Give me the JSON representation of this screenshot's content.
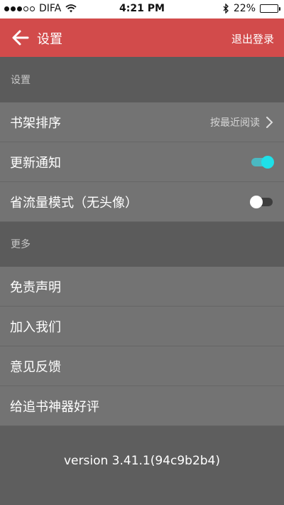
{
  "status_bar": {
    "carrier": "DIFA",
    "time": "4:21 PM",
    "battery": "22%",
    "battery_level": 0.22
  },
  "header": {
    "title": "设置",
    "logout_label": "退出登录"
  },
  "sections": {
    "settings_label": "设置",
    "more_label": "更多"
  },
  "settings": {
    "shelf_sort_label": "书架排序",
    "shelf_sort_value": "按最近阅读",
    "update_notify_label": "更新通知",
    "update_notify_on": true,
    "save_data_label": "省流量模式（无头像）",
    "save_data_on": false
  },
  "more": {
    "disclaimer_label": "免责声明",
    "join_us_label": "加入我们",
    "feedback_label": "意见反馈",
    "rate_label": "给追书神器好评"
  },
  "footer": {
    "version": "version 3.41.1(94c9b2b4)"
  },
  "colors": {
    "header_bg": "#d24b4b",
    "toggle_on": "#1ee0e8"
  }
}
